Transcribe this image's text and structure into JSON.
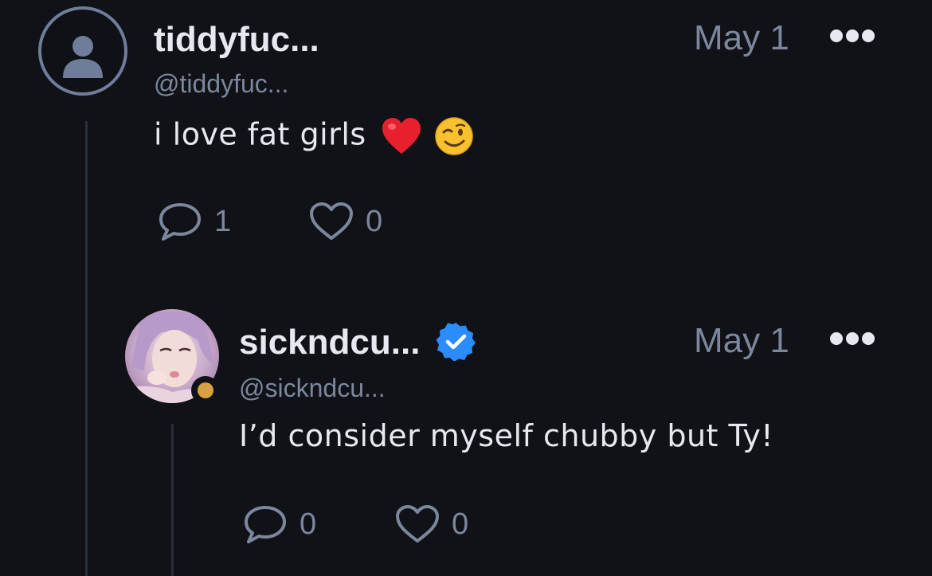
{
  "posts": [
    {
      "display_name": "tiddyfuc...",
      "handle": "@tiddyfuc...",
      "date": "May 1",
      "text": "i love fat girls",
      "emojis": [
        "red-heart",
        "winking-face"
      ],
      "reply_count": "1",
      "like_count": "0",
      "avatar": "default-user-icon",
      "verified": false
    },
    {
      "display_name": "sickndcu...",
      "handle": "@sickndcu...",
      "date": "May 1",
      "text": "I’d consider myself chubby but Ty!",
      "reply_count": "0",
      "like_count": "0",
      "avatar": "user-photo",
      "verified": true,
      "status_color": "#d9a042"
    }
  ],
  "icons": {
    "reply": "speech-bubble-icon",
    "like": "heart-outline-icon",
    "more": "three-dots-icon",
    "verified": "verified-check-badge-icon"
  },
  "colors": {
    "background": "#111217",
    "text_primary": "#e6e9f0",
    "text_secondary": "#7c879e",
    "verified": "#2a8cff"
  }
}
